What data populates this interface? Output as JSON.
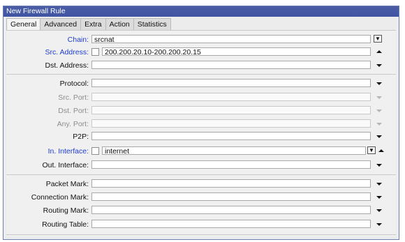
{
  "window": {
    "title": "New Firewall Rule"
  },
  "tabs": [
    {
      "label": "General"
    },
    {
      "label": "Advanced"
    },
    {
      "label": "Extra"
    },
    {
      "label": "Action"
    },
    {
      "label": "Statistics"
    }
  ],
  "fields": {
    "chain": {
      "label": "Chain:",
      "value": "srcnat"
    },
    "src_address": {
      "label": "Src. Address:",
      "value": "200.200.20.10-200.200.20.15"
    },
    "dst_address": {
      "label": "Dst. Address:",
      "value": ""
    },
    "protocol": {
      "label": "Protocol:",
      "value": ""
    },
    "src_port": {
      "label": "Src. Port:",
      "value": ""
    },
    "dst_port": {
      "label": "Dst. Port:",
      "value": ""
    },
    "any_port": {
      "label": "Any. Port:",
      "value": ""
    },
    "p2p": {
      "label": "P2P:",
      "value": ""
    },
    "in_interface": {
      "label": "In. Interface:",
      "value": "internet"
    },
    "out_interface": {
      "label": "Out. Interface:",
      "value": ""
    },
    "packet_mark": {
      "label": "Packet Mark:",
      "value": ""
    },
    "connection_mark": {
      "label": "Connection Mark:",
      "value": ""
    },
    "routing_mark": {
      "label": "Routing Mark:",
      "value": ""
    },
    "routing_table": {
      "label": "Routing Table:",
      "value": ""
    }
  },
  "colors": {
    "titlebar": "#3f54a3",
    "active_label": "#1e3cd0",
    "disabled_label": "#8c8c8c"
  },
  "icons": {
    "dropdown": "triangle-down-icon",
    "collapse": "triangle-up-icon",
    "select_button": "dropdown-button-icon"
  }
}
